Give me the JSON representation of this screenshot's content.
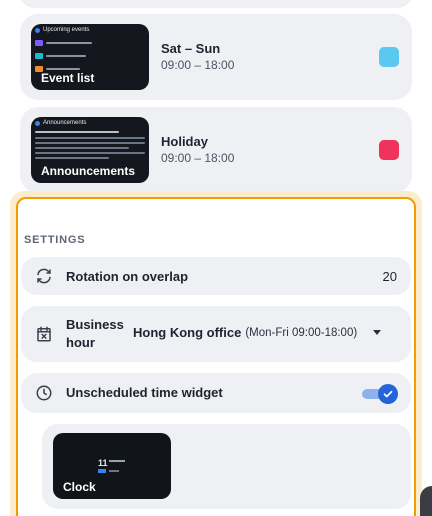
{
  "schedules": [
    {
      "widget": "Event list",
      "thumb_heading": "Upcoming events",
      "title": "Sat – Sun",
      "time": "09:00 – 18:00",
      "color": "#5bc8f0"
    },
    {
      "widget": "Announcements",
      "thumb_heading": "Announcements",
      "title": "Holiday",
      "time": "09:00 – 18:00",
      "color": "#f0335a"
    }
  ],
  "settings": {
    "heading": "SETTINGS",
    "rotation": {
      "label": "Rotation on overlap",
      "value": "20",
      "icon": "rotate-icon"
    },
    "business_hour": {
      "label": "Business hour",
      "selected": "Hong Kong office",
      "selected_detail": "(Mon-Fri 09:00-18:00)",
      "icon": "calendar-x-icon"
    },
    "unscheduled": {
      "label": "Unscheduled time widget",
      "enabled": true,
      "icon": "clock-icon"
    }
  },
  "unscheduled_widget": {
    "label": "Clock",
    "thumb_day": "11"
  },
  "colors": {
    "accent": "#f29b05",
    "toggle": "#2563d8",
    "card_bg": "#eef0f4"
  }
}
